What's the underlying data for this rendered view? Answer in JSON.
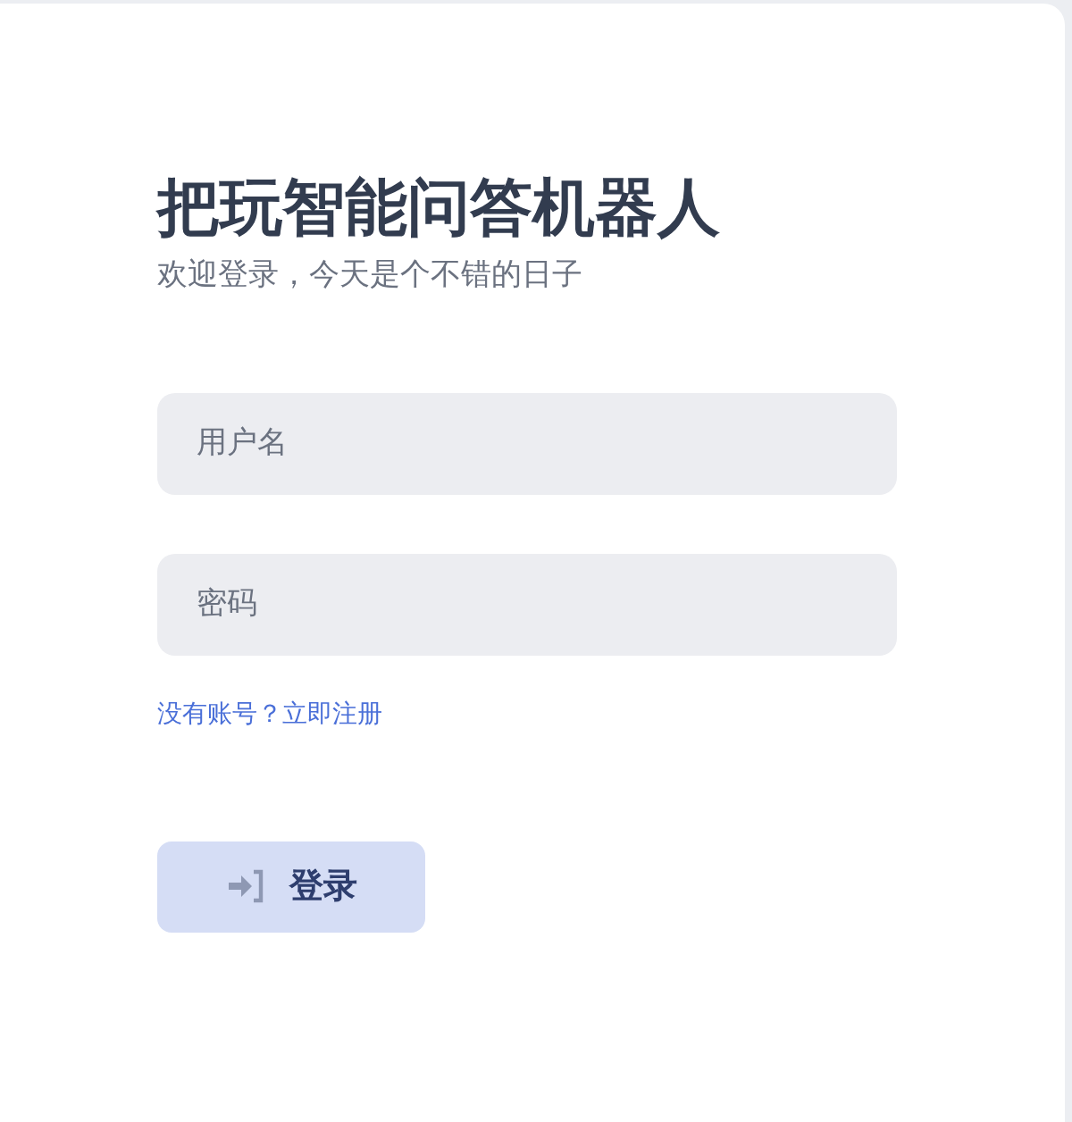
{
  "title": "把玩智能问答机器人",
  "subtitle": "欢迎登录，今天是个不错的日子",
  "username_field": {
    "placeholder": "用户名"
  },
  "password_field": {
    "placeholder": "密码"
  },
  "register_link": "没有账号？立即注册",
  "login_button": {
    "label": "登录"
  }
}
